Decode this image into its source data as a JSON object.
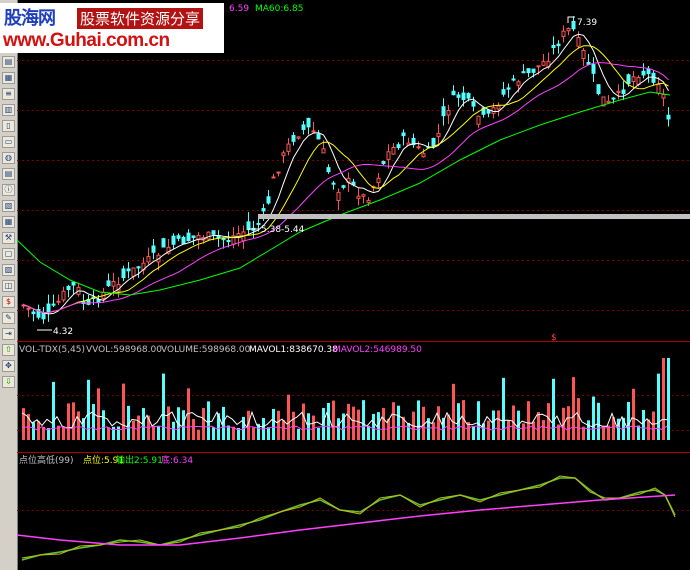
{
  "watermark": {
    "site_name": "股海网",
    "slogan": "股票软件资源分享",
    "url": "www.Guhai.com.cn"
  },
  "main_panel": {
    "ma_fragments": [
      {
        "text": "6.59",
        "color": "#ff40ff"
      },
      {
        "text": "MA60:6.85",
        "color": "#00ff00"
      }
    ],
    "price_high_label": "7.39",
    "price_low_label": "4.32",
    "range_label": "5.38-5.44",
    "scale_marker": "$"
  },
  "volume_panel": {
    "indicator_name": "VOL-TDX(5,45)",
    "vvol": "VVOL:598968.00",
    "volume": "VOLUME:598968.00",
    "mavol1": "MAVOL1:838670.38",
    "mavol2": "MAVOL2:546989.50"
  },
  "indicator_panel": {
    "indicator_name": "点位高低(99)",
    "point_value": "点位:5.91",
    "output_value": "输出2:5.91",
    "base_value": "底:6.34"
  },
  "colors": {
    "up": "#ff5454",
    "down": "#54ffff",
    "ma5": "#ffffff",
    "ma10": "#ffff00",
    "ma20": "#ff40ff",
    "ma60": "#00ff00",
    "grid": "#800000",
    "support": "#c0c0c0"
  },
  "toolbar_icons": [
    "chart-icon",
    "table-icon",
    "list-icon",
    "grid-icon",
    "document-icon",
    "folder-icon",
    "globe-icon",
    "news-icon",
    "info-icon",
    "stats-icon",
    "calendar-icon",
    "tools-icon",
    "window-icon",
    "chart-alt-icon",
    "index-icon",
    "money-icon",
    "pen-icon",
    "exit-icon",
    "up-arrow-icon",
    "move-icon",
    "down-arrow-icon"
  ]
}
